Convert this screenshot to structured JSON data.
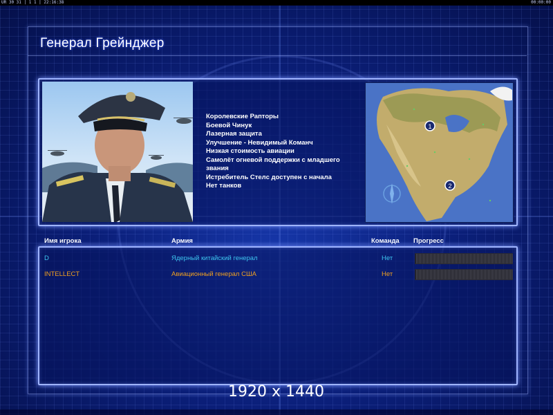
{
  "status_bar": {
    "left_text": "UR 30 31 | 1 1 | 22:16:38",
    "right_text": "00:00:00"
  },
  "title": "Генерал Грейнджер",
  "features": [
    "Королевские Рапторы",
    "Боевой Чинук",
    "Лазерная защита",
    "Улучшение - Невидимый Команч",
    "Низкая стоимость авиации",
    "Самолёт огневой поддержки с младшего",
    " звания",
    "Истребитель Стелс доступен с начала",
    "Нет танков"
  ],
  "map": {
    "markers": [
      {
        "label": "1"
      },
      {
        "label": "2"
      }
    ]
  },
  "table": {
    "headers": {
      "player": "Имя игрока",
      "army": "Армия",
      "team": "Команда",
      "progress": "Прогресс"
    },
    "rows": [
      {
        "player": "D",
        "army": "Ядерный китайский генерал",
        "team": "Нет",
        "progress": 0,
        "color": "#3ec6f0"
      },
      {
        "player": "INTELLECT",
        "army": "Авиационный генерал США",
        "team": "Нет",
        "progress": 0,
        "color": "#f0a020"
      }
    ]
  },
  "resolution_label": "1920 x 1440",
  "colors": {
    "panel_border": "#9fb4ff",
    "background": "#0b1f7a",
    "text": "#ffffff"
  }
}
